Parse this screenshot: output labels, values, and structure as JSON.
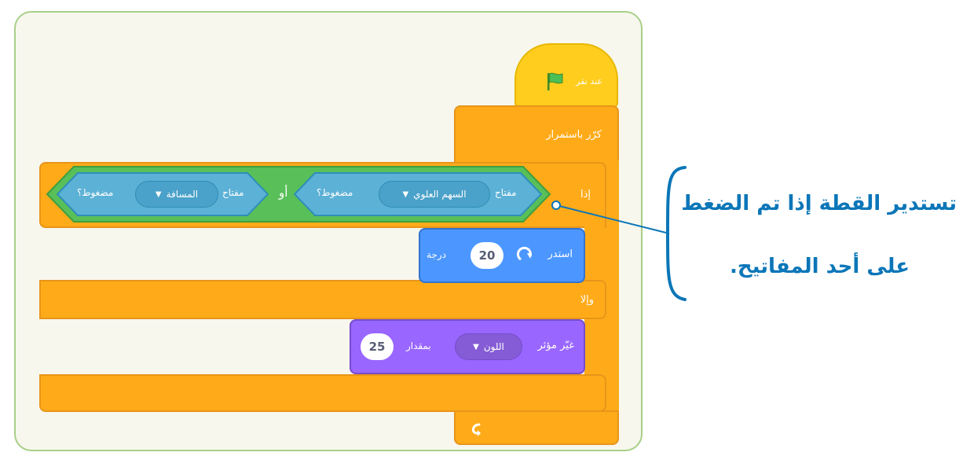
{
  "blocks": {
    "hat": {
      "label": "عند نقر"
    },
    "forever": {
      "label": "كرّر باستمرار"
    },
    "if_block": {
      "if_label": "إذا",
      "else_label": "وإلا"
    },
    "condition": {
      "or_label": "أو",
      "key1": {
        "prefix": "مفتاح",
        "key": "السهم العلوي",
        "suffix": "مضغوط؟"
      },
      "key2": {
        "prefix": "مفتاح",
        "key": "المسافة",
        "suffix": "مضغوط؟"
      }
    },
    "turn": {
      "label": "استدر",
      "value": "20",
      "unit": "درجة"
    },
    "effect": {
      "label": "غيّر مؤثر",
      "effect": "اللون",
      "by": "بمقدار",
      "value": "25"
    }
  },
  "annotation": {
    "line1": "تستدير القطة إذا تم الضغط",
    "line2": "على أحد المفاتيح."
  },
  "colors": {
    "events": "#ffcd1e",
    "control": "#ffab19",
    "sensing": "#5cb1d6",
    "operators": "#59c059",
    "motion": "#4c97ff",
    "looks": "#9966ff",
    "annotation": "#0b76b8"
  }
}
